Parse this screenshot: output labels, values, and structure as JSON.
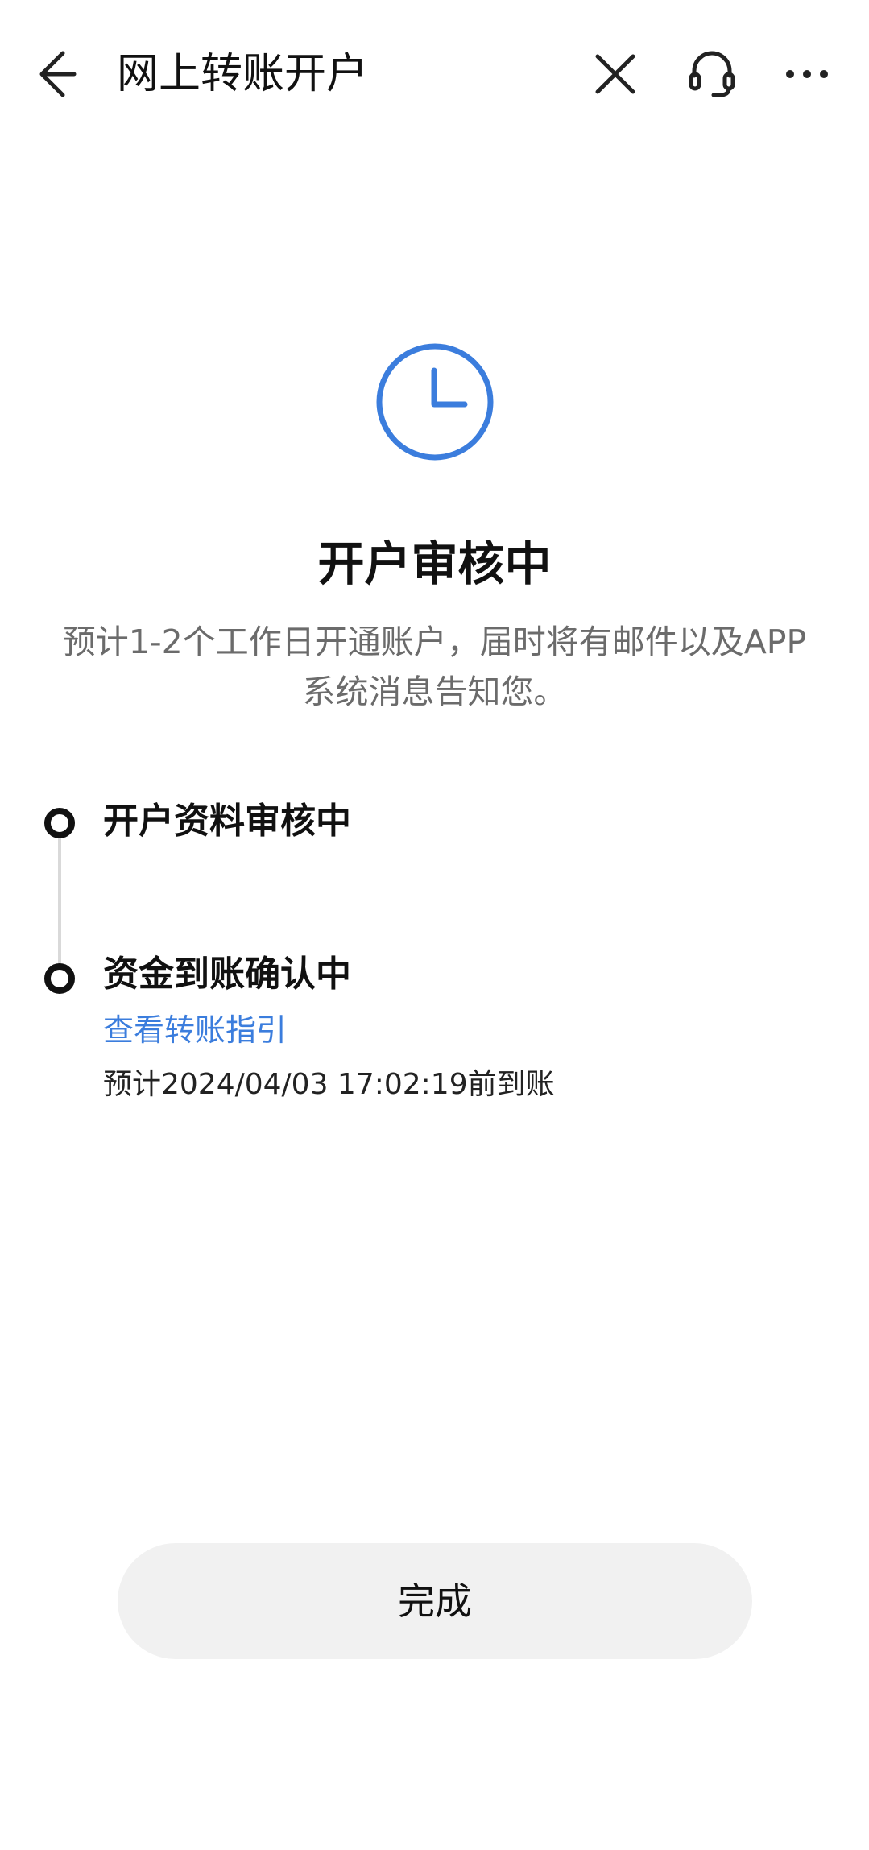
{
  "header": {
    "title": "网上转账开户",
    "back_icon": "arrow-left-icon",
    "close_icon": "close-icon",
    "service_icon": "headset-icon",
    "more_icon": "more-horizontal-icon"
  },
  "status": {
    "icon": "clock-icon",
    "icon_color": "#3b7ddd",
    "title": "开户审核中",
    "description": "预计1-2个工作日开通账户，届时将有邮件以及APP系统消息告知您。"
  },
  "timeline": {
    "steps": [
      {
        "title": "开户资料审核中"
      },
      {
        "title": "资金到账确认中",
        "link": "查看转账指引",
        "eta": "预计2024/04/03 17:02:19前到账"
      }
    ],
    "link_color": "#3b7ddd"
  },
  "footer": {
    "done_label": "完成"
  }
}
